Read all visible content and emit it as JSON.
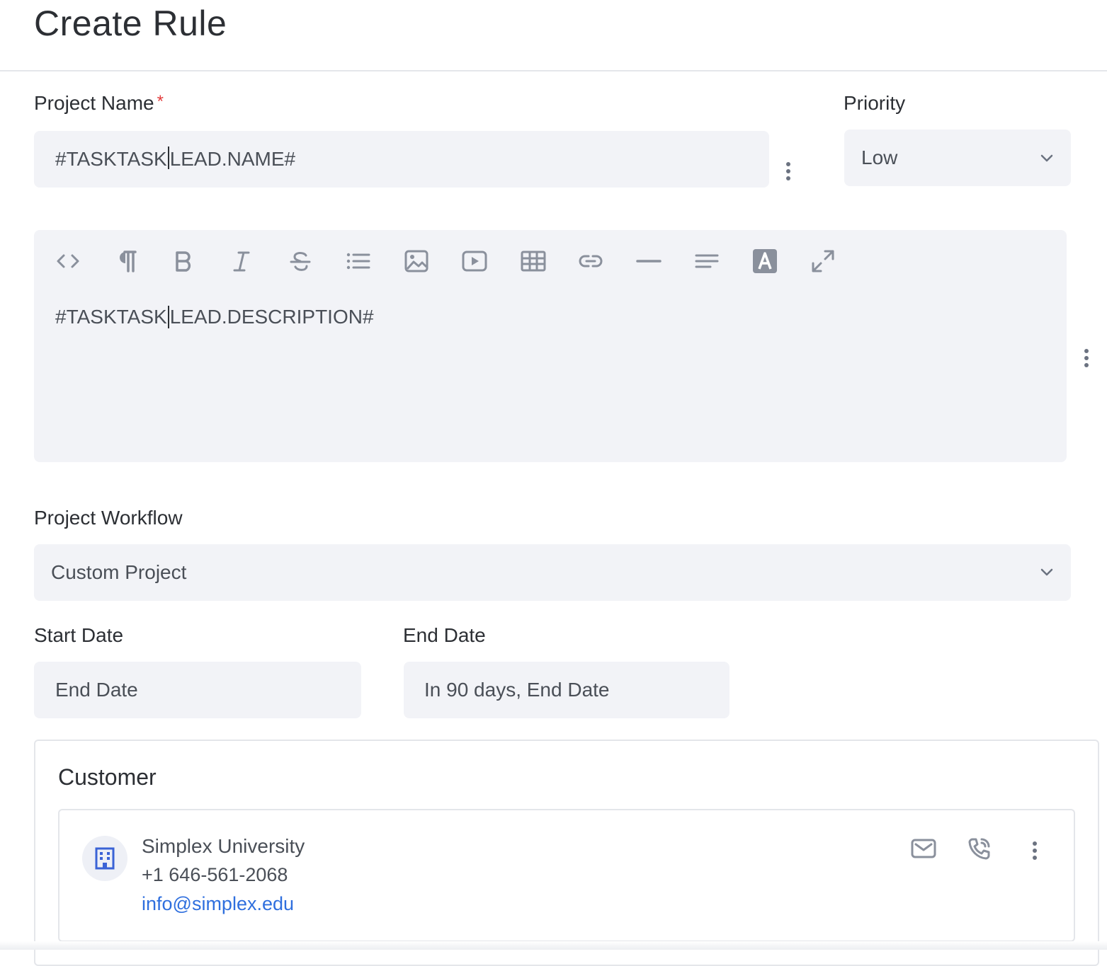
{
  "page": {
    "title": "Create Rule"
  },
  "project_name": {
    "label": "Project Name",
    "required_marker": "*",
    "value_before_cursor": "#TASKTASK",
    "value_after_cursor": "LEAD.NAME#"
  },
  "priority": {
    "label": "Priority",
    "selected": "Low"
  },
  "editor": {
    "toolbar": [
      "code-view",
      "paragraph",
      "bold",
      "italic",
      "strikethrough",
      "bulleted-list",
      "insert-image",
      "insert-video",
      "insert-table",
      "insert-link",
      "horizontal-line",
      "align",
      "text-color",
      "fullscreen"
    ],
    "content_before_cursor": "#TASKTASK",
    "content_after_cursor": "LEAD.DESCRIPTION#"
  },
  "project_workflow": {
    "label": "Project Workflow",
    "selected": "Custom Project"
  },
  "start_date": {
    "label": "Start Date",
    "value": "End Date"
  },
  "end_date": {
    "label": "End Date",
    "value": "In 90 days, End Date"
  },
  "customer": {
    "heading": "Customer",
    "name": "Simplex University",
    "phone": "+1 646-561-2068",
    "email": "info@simplex.edu"
  },
  "colors": {
    "link": "#2f6fde",
    "field_bg": "#f2f3f7",
    "required": "#e23b3b",
    "icon": "#8a909c"
  }
}
